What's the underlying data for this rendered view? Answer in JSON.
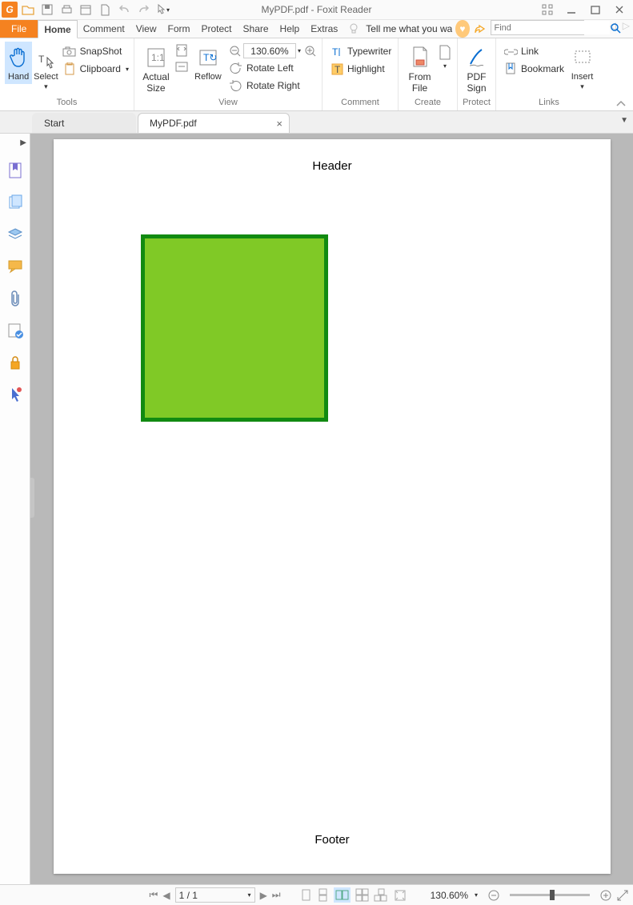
{
  "app": {
    "title": "MyPDF.pdf - Foxit Reader"
  },
  "menubar": {
    "file": "File",
    "items": [
      "Home",
      "Comment",
      "View",
      "Form",
      "Protect",
      "Share",
      "Help",
      "Extras"
    ],
    "tell_me": "Tell me what you wa",
    "find_placeholder": "Find"
  },
  "ribbon": {
    "tools": {
      "label": "Tools",
      "hand": "Hand",
      "select": "Select",
      "snapshot": "SnapShot",
      "clipboard": "Clipboard"
    },
    "view": {
      "label": "View",
      "actual_size_1": "Actual",
      "actual_size_2": "Size",
      "reflow": "Reflow",
      "zoom": "130.60%",
      "rotate_left": "Rotate Left",
      "rotate_right": "Rotate Right"
    },
    "comment": {
      "label": "Comment",
      "typewriter": "Typewriter",
      "highlight": "Highlight"
    },
    "create": {
      "label": "Create",
      "from_file_1": "From",
      "from_file_2": "File"
    },
    "protect": {
      "label": "Protect",
      "pdf_sign_1": "PDF",
      "pdf_sign_2": "Sign"
    },
    "links": {
      "label": "Links",
      "link": "Link",
      "bookmark": "Bookmark",
      "insert": "Insert"
    }
  },
  "tabs": {
    "start": "Start",
    "doc": "MyPDF.pdf"
  },
  "document": {
    "header": "Header",
    "footer": "Footer"
  },
  "status": {
    "page": "1 / 1",
    "zoom": "130.60%"
  }
}
